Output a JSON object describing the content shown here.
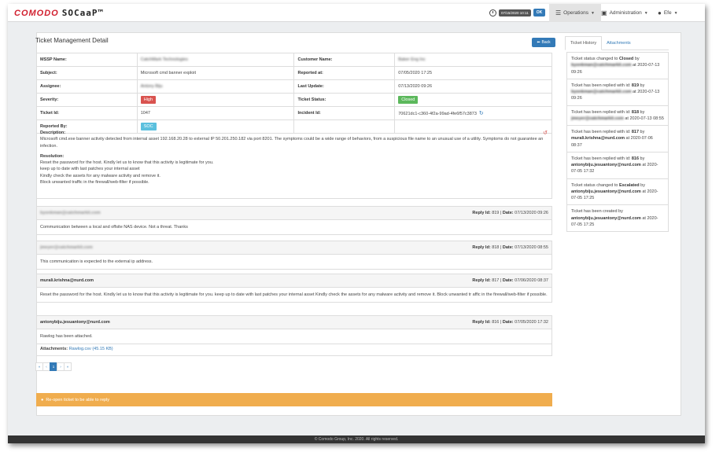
{
  "brand": {
    "name1": "COMODO",
    "name2": "SOCaaP™"
  },
  "topnav": {
    "clock_time": "07/15/2020 10:11",
    "clock_ok": "OK",
    "operations": "Operations",
    "administration": "Administration",
    "user": "Efe"
  },
  "page": {
    "title": "Ticket Management Detail",
    "back": "Back"
  },
  "details": {
    "mssp_label": "MSSP Name:",
    "mssp_value": "CatchMark Technologies",
    "customer_label": "Customer Name:",
    "customer_value": "Baker Eng Inc",
    "subject_label": "Subject:",
    "subject_value": "Microsoft cmd banner exploit",
    "reported_at_label": "Reported at:",
    "reported_at_value": "07/05/2020 17:25",
    "assignee_label": "Assignee:",
    "assignee_value": "Antony Biju",
    "last_update_label": "Last Update:",
    "last_update_value": "07/13/2020 09:26",
    "severity_label": "Severity:",
    "severity_value": "High",
    "status_label": "Ticket Status:",
    "status_value": "Closed",
    "ticket_id_label": "Ticket Id:",
    "ticket_id_value": "1047",
    "incident_label": "Incident Id:",
    "incident_value": "70621dc1-c360-4f2a-99ad-4fe6f57c3873",
    "reported_by_label": "Reported By:",
    "reported_by_value": "SOC"
  },
  "description": {
    "label": "Description:",
    "text": "Microsoft cmd.exe banner activity detected from internal asset 192.168.20.28 to external IP 50.201.250.182 via port 8201. The symptoms could be a wide range of behaviors, from a suspicious file name to an unusual use of a utility. Symptoms do not guarantee an infection.",
    "resolution_label": "Resolution:",
    "resolution_lines": [
      "Reset the password for the host. Kindly let us to know that this activity is legitimate for you.",
      "keep up to date with last patches your internal asset",
      "Kindly check the assets for any malware activity and remove it.",
      "Block unwanted traffic in the firewall/web-filter if possible."
    ]
  },
  "replies": [
    {
      "who": "byonkman@catchmarkit.com",
      "reply_id_label": "Reply Id:",
      "reply_id": "819",
      "date_label": "Date:",
      "date": "07/13/2020 09:26",
      "body": "Communication between a local and offsite NAS device. Not a threat. Thanks"
    },
    {
      "who": "jmeyer@catchmarkit.com",
      "reply_id_label": "Reply Id:",
      "reply_id": "818",
      "date_label": "Date:",
      "date": "07/13/2020 08:55",
      "body": "This communication is expected to the external ip address."
    },
    {
      "who": "murali.krishna@nurd.com",
      "reply_id_label": "Reply Id:",
      "reply_id": "817",
      "date_label": "Date:",
      "date": "07/06/2020 08:37",
      "body": "Reset the password for the host. Kindly let us to know that this activity is legitimate for you. keep up to date with last patches your internal asset Kindly check the assets for any malware activity and remove it. Block unwanted tr affic in the firewall/web-filter if possible."
    },
    {
      "who": "antonybiju.jesuantony@nurd.com",
      "reply_id_label": "Reply Id:",
      "reply_id": "816",
      "date_label": "Date:",
      "date": "07/05/2020 17:32",
      "body": "Rawlog has been attached.",
      "attachments_label": "Attachments:",
      "attachment": "Rawlog.csv (45.15 KB)"
    }
  ],
  "pager": {
    "first": "«",
    "prev": "‹",
    "current": "1",
    "next": "›",
    "last": "»"
  },
  "warning": "Re-open ticket to be able to reply",
  "sidebar": {
    "tab_history": "Ticket History",
    "tab_attachments": "Attachments",
    "items": [
      {
        "pre": "Ticket status changed to ",
        "bold": "Closed",
        "mid": " by ",
        "user": "byonkman@catchmarkit.com",
        "post": " at 2020-07-13 09:26"
      },
      {
        "pre": "Ticket has been replied with id: ",
        "bold": "819",
        "mid": " by ",
        "user": "byonkman@catchmarkit.com",
        "post": " at 2020-07-13 09:26"
      },
      {
        "pre": "Ticket has been replied with id: ",
        "bold": "818",
        "mid": " by ",
        "user": "jmeyer@catchmarkit.com",
        "post": " at 2020-07-13 08:55"
      },
      {
        "pre": "Ticket has been replied with id: ",
        "bold": "817",
        "mid": " by ",
        "user": "murali.krishna@nurd.com",
        "post": " at 2020-07-06 08:37"
      },
      {
        "pre": "Ticket has been replied with id: ",
        "bold": "816",
        "mid": " by ",
        "user": "antonybiju.jesuantony@nurd.com",
        "post": " at 2020-07-05 17:32"
      },
      {
        "pre": "Ticket status changed to ",
        "bold": "Escalated",
        "mid": " by ",
        "user": "antonybiju.jesuantony@nurd.com",
        "post": " at 2020-07-05 17:25"
      },
      {
        "pre": "Ticket has been created by ",
        "bold": "",
        "mid": "",
        "user": "antonybiju.jesuantony@nurd.com",
        "post": " at 2020-07-05 17:25"
      }
    ]
  },
  "footer": "© Comodo Group, Inc. 2020. All rights reserved."
}
